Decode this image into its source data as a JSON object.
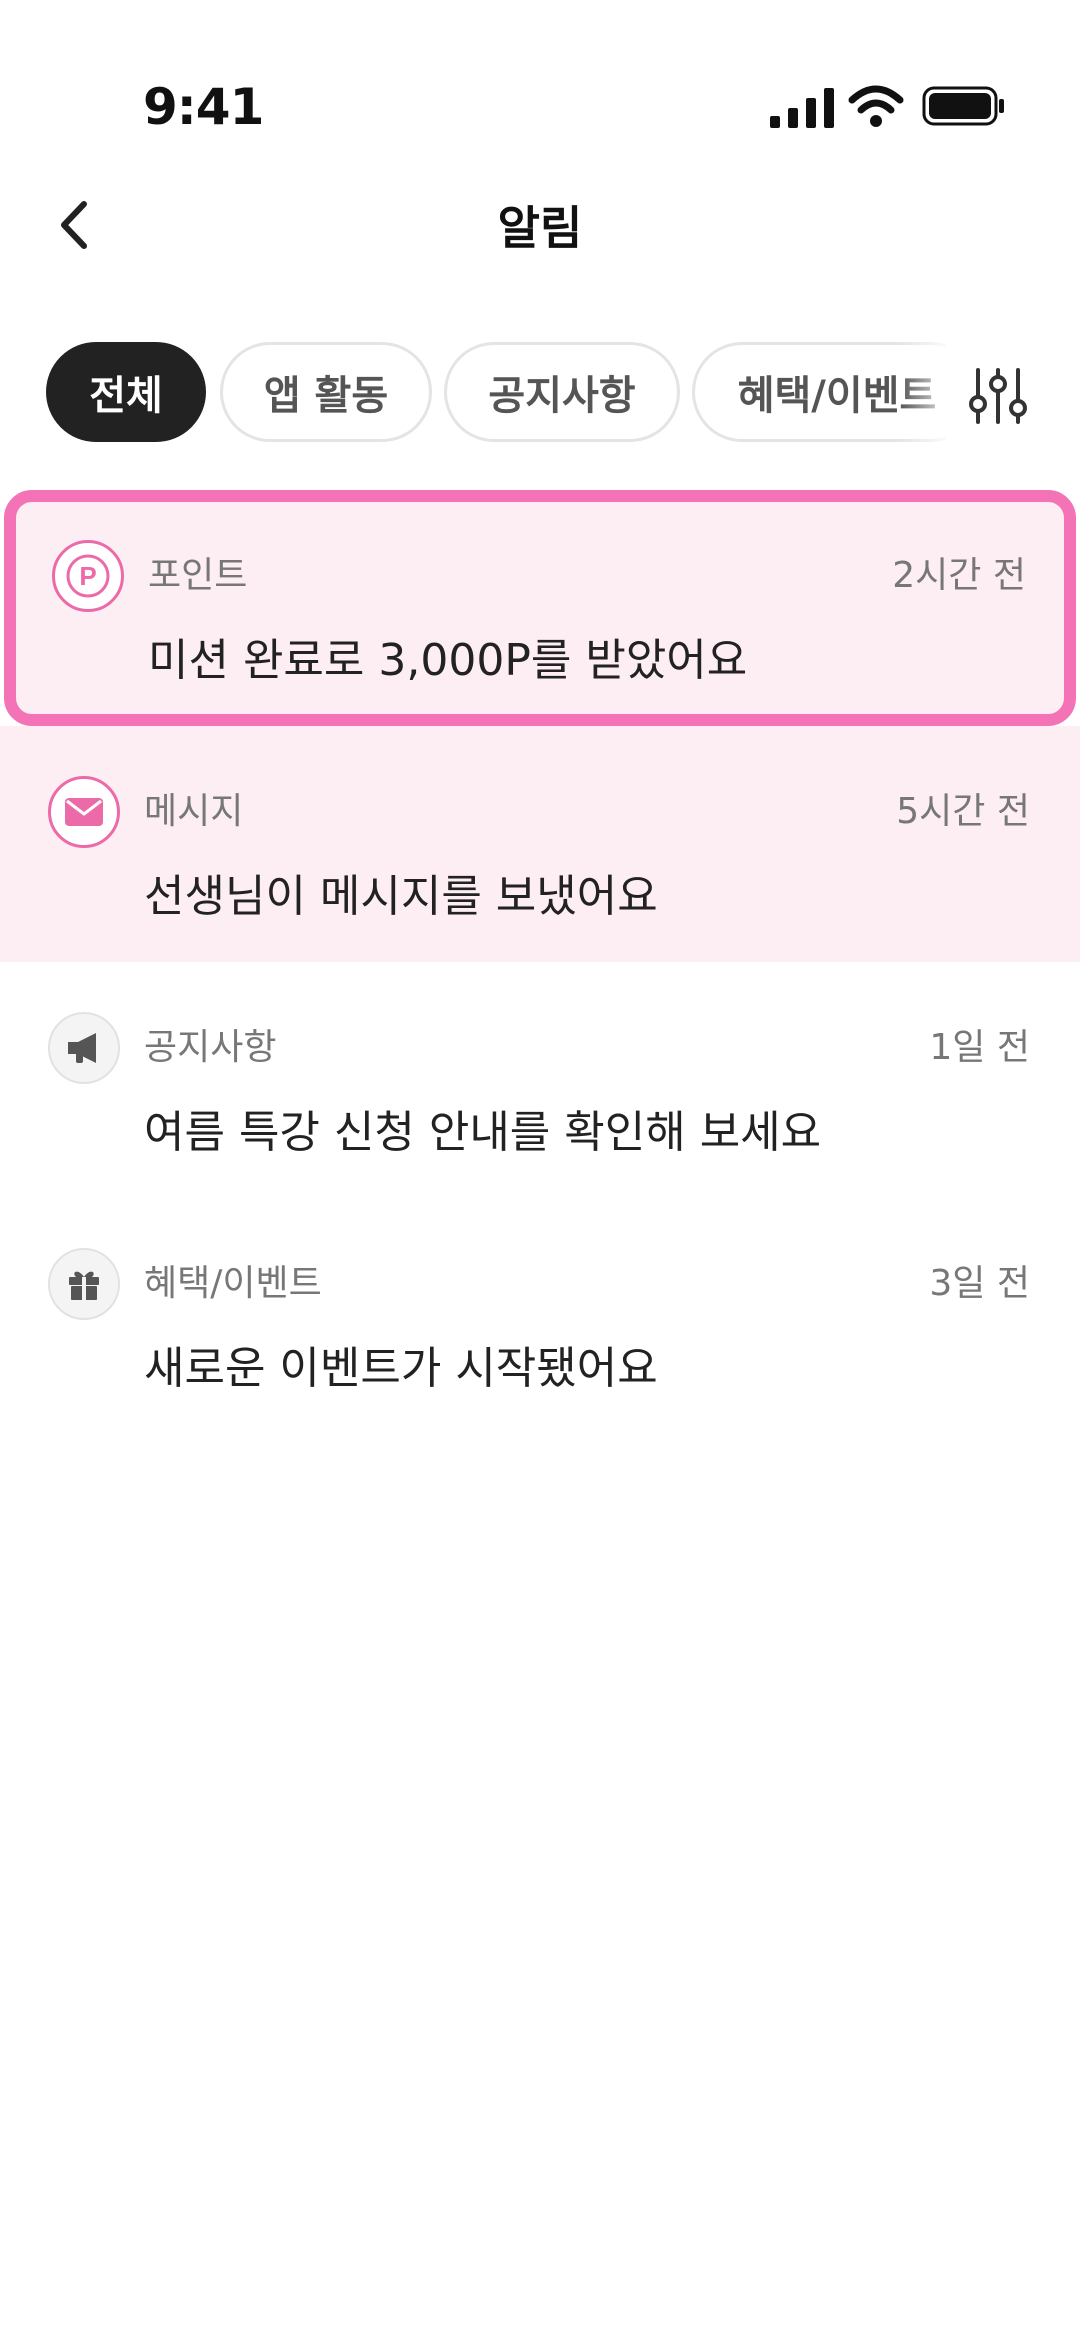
{
  "status_bar": {
    "time": "9:41"
  },
  "header": {
    "title": "알림"
  },
  "tabs": [
    {
      "label": "전체",
      "active": true
    },
    {
      "label": "앱 활동",
      "active": false
    },
    {
      "label": "공지사항",
      "active": false
    },
    {
      "label": "혜택/이벤트",
      "active": false
    }
  ],
  "notifications": [
    {
      "category": "포인트",
      "time": "2시간 전",
      "message": "미션 완료로 3,000P를 받았어요",
      "icon": "point-icon",
      "unread": true,
      "selected": true
    },
    {
      "category": "메시지",
      "time": "5시간 전",
      "message": "선생님이 메시지를 보냈어요",
      "icon": "mail-icon",
      "unread": true,
      "selected": false
    },
    {
      "category": "공지사항",
      "time": "1일 전",
      "message": "여름 특강 신청 안내를 확인해 보세요",
      "icon": "megaphone-icon",
      "unread": false,
      "selected": false
    },
    {
      "category": "혜택/이벤트",
      "time": "3일 전",
      "message": "새로운 이벤트가 시작됐어요",
      "icon": "gift-icon",
      "unread": false,
      "selected": false
    }
  ],
  "colors": {
    "accent_pink": "#f472b6",
    "unread_bg": "#fdeef3",
    "active_tab": "#222222"
  }
}
